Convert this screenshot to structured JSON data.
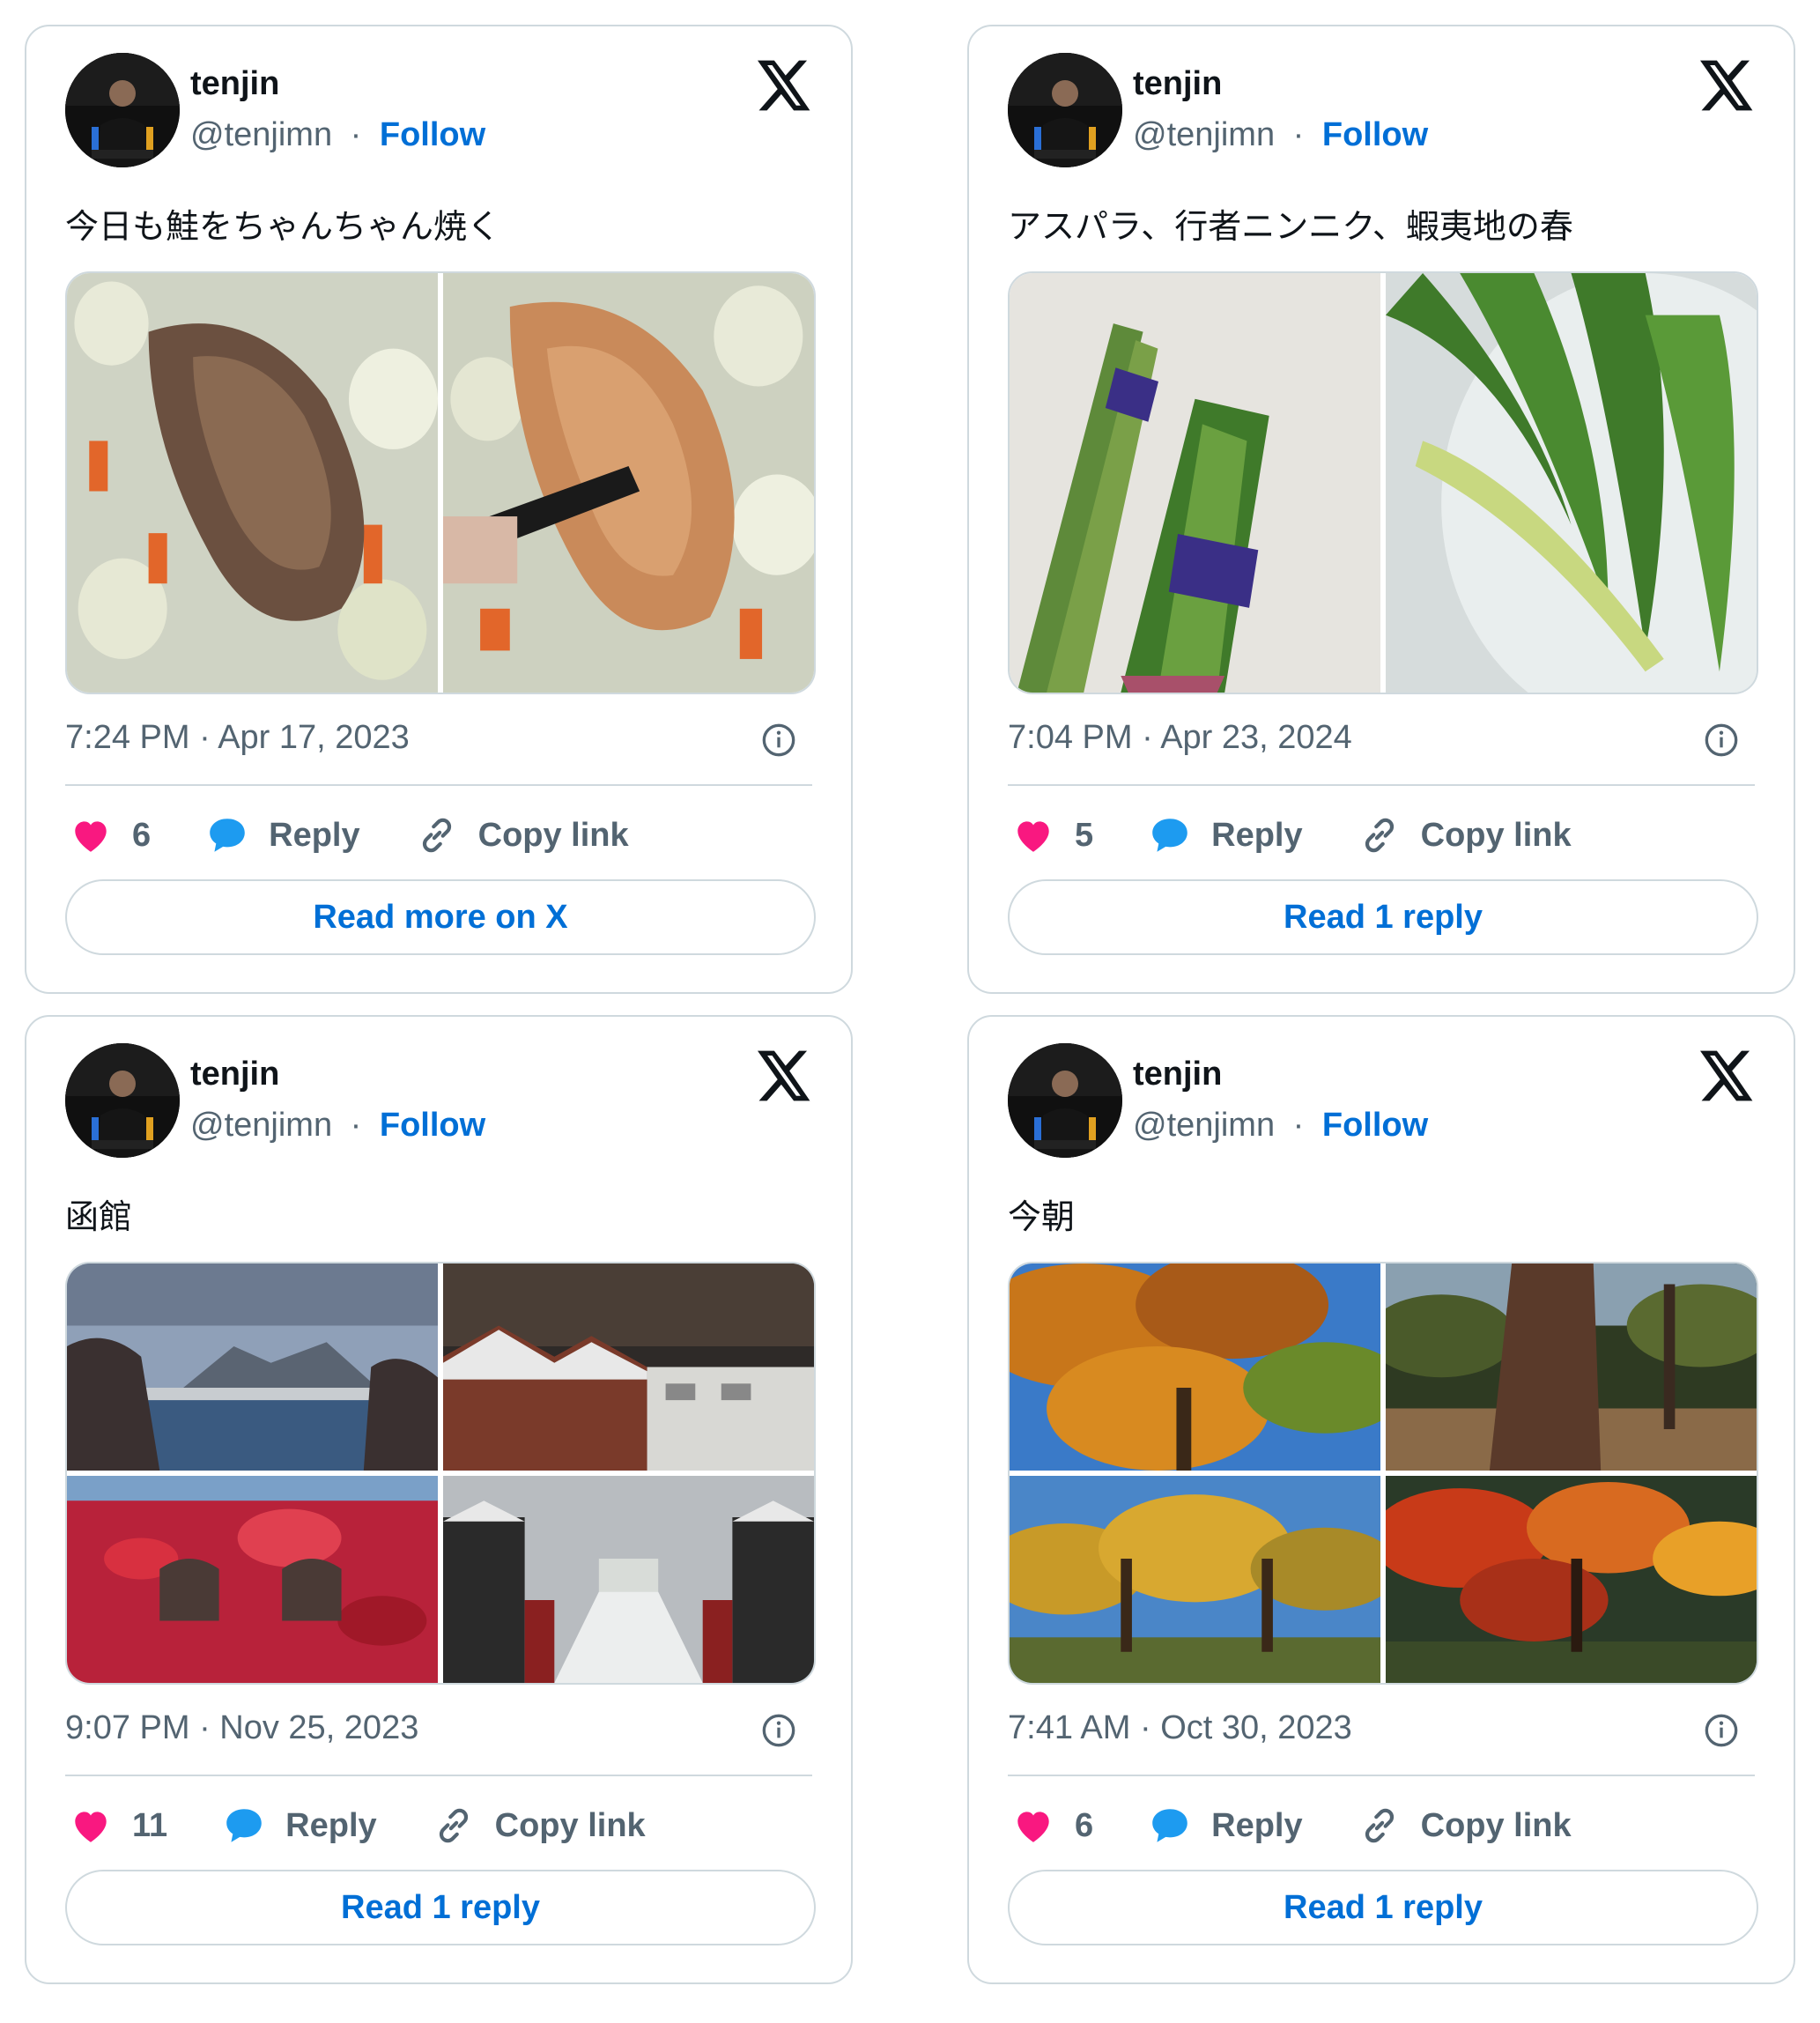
{
  "colors": {
    "accent": "#006fd6",
    "heart": "#f91880",
    "reply": "#1d9bf0",
    "muted": "#536471",
    "border": "#cfd9de"
  },
  "icons": {
    "brand": "x-logo-icon",
    "like": "heart-icon",
    "reply": "speech-bubble-icon",
    "copy": "link-icon",
    "info": "info-icon"
  },
  "tweets": [
    {
      "name": "tenjin",
      "handle": "@tenjimn",
      "separator": "·",
      "follow": "Follow",
      "text": "今日も鮭をちゃんちゃん焼く",
      "timestamp": "7:24 PM · Apr 17, 2023",
      "likes": "6",
      "reply": "Reply",
      "copy": "Copy link",
      "cta": "Read more on X",
      "media_count": 2
    },
    {
      "name": "tenjin",
      "handle": "@tenjimn",
      "separator": "·",
      "follow": "Follow",
      "text": "アスパラ、行者ニンニク、蝦夷地の春",
      "timestamp": "7:04 PM · Apr 23, 2024",
      "likes": "5",
      "reply": "Reply",
      "copy": "Copy link",
      "cta": "Read 1 reply",
      "media_count": 2
    },
    {
      "name": "tenjin",
      "handle": "@tenjimn",
      "separator": "·",
      "follow": "Follow",
      "text": "函館",
      "timestamp": "9:07 PM · Nov 25, 2023",
      "likes": "11",
      "reply": "Reply",
      "copy": "Copy link",
      "cta": "Read 1 reply",
      "media_count": 4
    },
    {
      "name": "tenjin",
      "handle": "@tenjimn",
      "separator": "·",
      "follow": "Follow",
      "text": "今朝",
      "timestamp": "7:41 AM · Oct 30, 2023",
      "likes": "6",
      "reply": "Reply",
      "copy": "Copy link",
      "cta": "Read 1 reply",
      "media_count": 4
    }
  ]
}
